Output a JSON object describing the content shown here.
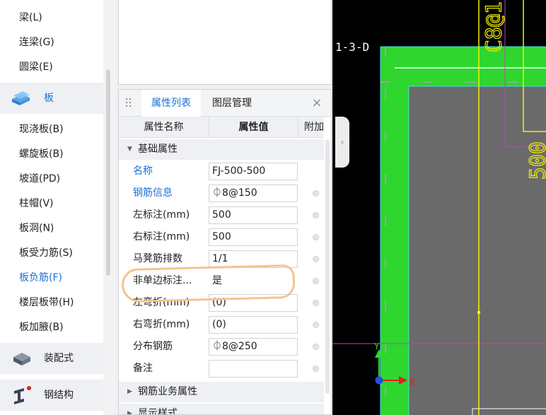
{
  "sidebar": {
    "items_top": [
      {
        "label": "梁(L)"
      },
      {
        "label": "连梁(G)"
      },
      {
        "label": "圆梁(E)"
      }
    ],
    "category_slab": {
      "label": "板",
      "icon": "slab-icon"
    },
    "items_slab": [
      {
        "label": "现浇板(B)"
      },
      {
        "label": "螺旋板(B)"
      },
      {
        "label": "坡道(PD)"
      },
      {
        "label": "柱帽(V)"
      },
      {
        "label": "板洞(N)"
      },
      {
        "label": "板受力筋(S)"
      },
      {
        "label": "板负筋(F)",
        "active": true
      },
      {
        "label": "楼层板带(H)"
      },
      {
        "label": "板加腋(B)"
      }
    ],
    "category_prefab": {
      "label": "装配式",
      "icon": "prefab-icon"
    },
    "category_steel": {
      "label": "钢结构",
      "icon": "steel-beam-icon"
    }
  },
  "properties": {
    "tabs": [
      {
        "label": "属性列表",
        "active": true
      },
      {
        "label": "图层管理",
        "active": false
      }
    ],
    "close_icon": "close-icon",
    "columns": {
      "name": "属性名称",
      "value": "属性值",
      "extra": "附加"
    },
    "group_basic": "基础属性",
    "rows": [
      {
        "name": "名称",
        "value": "FJ-500-500",
        "link": true,
        "has_extra": false
      },
      {
        "name": "钢筋信息",
        "value": "⏀8@150",
        "link": true,
        "has_extra": true
      },
      {
        "name": "左标注(mm)",
        "value": "500",
        "link": false,
        "has_extra": true
      },
      {
        "name": "右标注(mm)",
        "value": "500",
        "link": false,
        "has_extra": true
      },
      {
        "name": "马凳筋排数",
        "value": "1/1",
        "link": false,
        "has_extra": true
      },
      {
        "name": "非单边标注...",
        "value": "是",
        "link": false,
        "has_extra": true
      },
      {
        "name": "左弯折(mm)",
        "value": "(0)",
        "link": false,
        "has_extra": true
      },
      {
        "name": "右弯折(mm)",
        "value": "(0)",
        "link": false,
        "has_extra": true
      },
      {
        "name": "分布钢筋",
        "value": "⏀8@250",
        "link": false,
        "has_extra": true
      },
      {
        "name": "备注",
        "value": "",
        "link": false,
        "has_extra": true
      }
    ],
    "group_rebar_business": "钢筋业务属性",
    "group_display_style": "显示样式"
  },
  "canvas": {
    "axis_label": "1-3-D",
    "rebar_label_top": "C8@1",
    "rebar_label_right": "500",
    "ucs_x_label": "X",
    "ucs_y_label": "Y",
    "colors": {
      "background": "#000000",
      "slab_fill": "#2ed62e",
      "slab_inner": "#6a6a6a",
      "rebar_line": "#f2f200",
      "magenta_line": "#c040c0",
      "cyan_edge": "#40e0e0"
    }
  }
}
